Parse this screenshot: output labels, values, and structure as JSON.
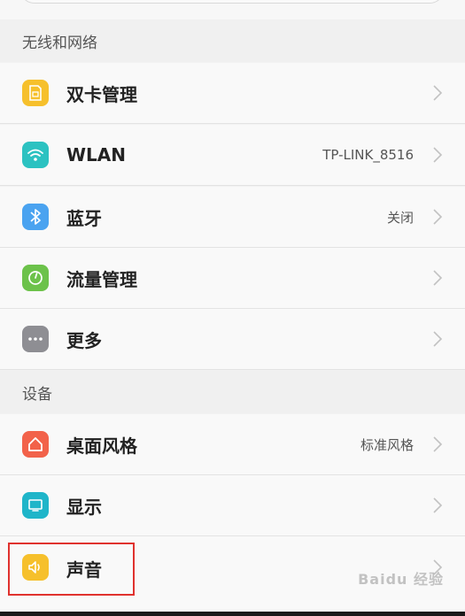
{
  "sections": {
    "wireless": "无线和网络",
    "device": "设备"
  },
  "rows": {
    "dual_sim": {
      "label": "双卡管理"
    },
    "wlan": {
      "label": "WLAN",
      "value": "TP-LINK_8516"
    },
    "bluetooth": {
      "label": "蓝牙",
      "value": "关闭"
    },
    "data_usage": {
      "label": "流量管理"
    },
    "more": {
      "label": "更多"
    },
    "home_style": {
      "label": "桌面风格",
      "value": "标准风格"
    },
    "display": {
      "label": "显示"
    },
    "sound": {
      "label": "声音"
    }
  },
  "icons": {
    "dual_sim": {
      "name": "sim-card-icon",
      "color": "#f6c02c"
    },
    "wlan": {
      "name": "wifi-icon",
      "color": "#2cc2c1"
    },
    "bluetooth": {
      "name": "bluetooth-icon",
      "color": "#4aa3f0"
    },
    "data_usage": {
      "name": "data-gauge-icon",
      "color": "#6cc24a"
    },
    "more": {
      "name": "more-dots-icon",
      "color": "#8e8e93"
    },
    "home_style": {
      "name": "home-icon",
      "color": "#f2624a"
    },
    "display": {
      "name": "display-icon",
      "color": "#1fb5c9"
    },
    "sound": {
      "name": "speaker-icon",
      "color": "#f6c02c"
    }
  },
  "highlight_color": "#e0322e",
  "watermark": "Baidu 经验"
}
